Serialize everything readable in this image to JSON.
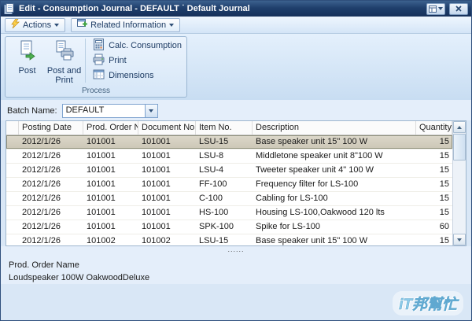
{
  "window": {
    "title": "Edit - Consumption Journal - DEFAULT ˙ Default Journal"
  },
  "menubar": {
    "actions_label": "Actions",
    "related_info_label": "Related Information"
  },
  "ribbon": {
    "post_label": "Post",
    "post_and_print_label": "Post and Print",
    "calc_consumption_label": "Calc. Consumption",
    "print_label": "Print",
    "dimensions_label": "Dimensions",
    "group_label": "Process"
  },
  "batch": {
    "label": "Batch Name:",
    "value": "DEFAULT"
  },
  "grid": {
    "columns": [
      "Posting Date",
      "Prod. Order No.",
      "Document No.",
      "Item No.",
      "Description",
      "Quantity"
    ],
    "selected_index": 0,
    "rows": [
      [
        "2012/1/26",
        "101001",
        "101001",
        "LSU-15",
        "Base speaker unit 15\" 100 W",
        "15"
      ],
      [
        "2012/1/26",
        "101001",
        "101001",
        "LSU-8",
        "Middletone speaker unit 8\"100 W",
        "15"
      ],
      [
        "2012/1/26",
        "101001",
        "101001",
        "LSU-4",
        "Tweeter speaker unit 4\" 100 W",
        "15"
      ],
      [
        "2012/1/26",
        "101001",
        "101001",
        "FF-100",
        "Frequency filter for LS-100",
        "15"
      ],
      [
        "2012/1/26",
        "101001",
        "101001",
        "C-100",
        "Cabling for LS-100",
        "15"
      ],
      [
        "2012/1/26",
        "101001",
        "101001",
        "HS-100",
        "Housing LS-100,Oakwood 120 lts",
        "15"
      ],
      [
        "2012/1/26",
        "101001",
        "101001",
        "SPK-100",
        "Spike for LS-100",
        "60"
      ],
      [
        "2012/1/26",
        "101002",
        "101002",
        "LSU-15",
        "Base speaker unit 15\" 100 W",
        "15"
      ]
    ],
    "more_indicator": "......"
  },
  "footer": {
    "label": "Prod. Order Name",
    "value": "Loudspeaker 100W OakwoodDeluxe"
  },
  "watermark": "iT邦幫忙"
}
